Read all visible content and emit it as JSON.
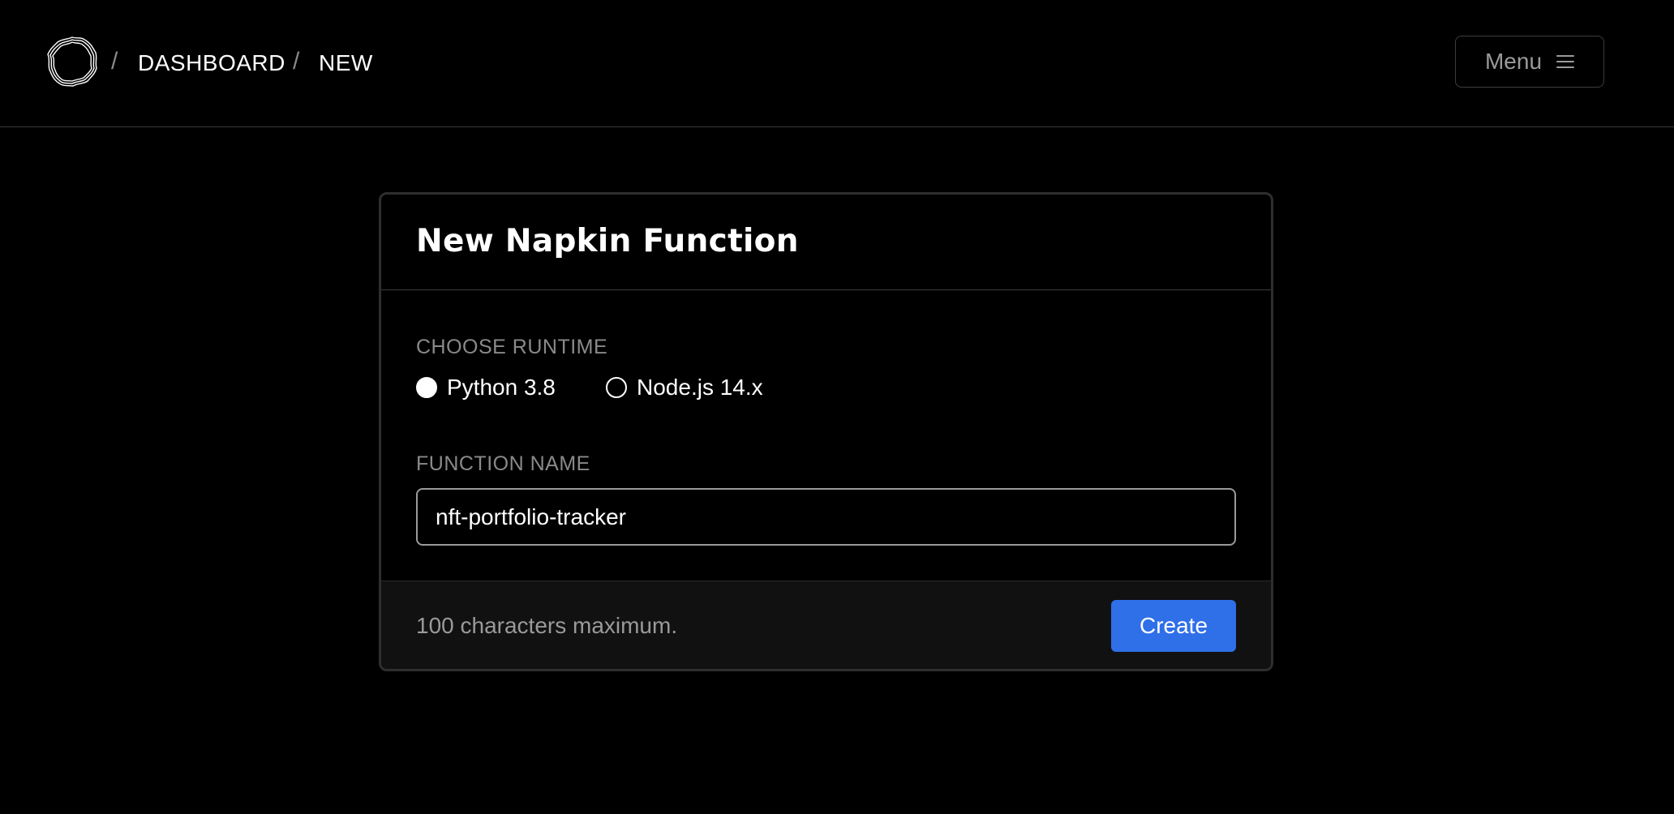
{
  "header": {
    "logo_icon": "napkin-logo-icon",
    "breadcrumb": {
      "separator": "/",
      "items": [
        {
          "label": "DASHBOARD"
        },
        {
          "label": "NEW"
        }
      ]
    },
    "menu": {
      "label": "Menu",
      "icon": "hamburger-icon"
    }
  },
  "form": {
    "title": "New Napkin Function",
    "runtime": {
      "label": "CHOOSE RUNTIME",
      "options": [
        {
          "label": "Python 3.8",
          "checked": true
        },
        {
          "label": "Node.js 14.x",
          "checked": false
        }
      ]
    },
    "function_name": {
      "label": "FUNCTION NAME",
      "value": "nft-portfolio-tracker"
    },
    "footer": {
      "note": "100 characters maximum.",
      "submit_label": "Create"
    }
  },
  "colors": {
    "background": "#000000",
    "accent": "#2f6fe8",
    "border": "#2e2e2e",
    "muted_text": "#8a8a8a"
  }
}
